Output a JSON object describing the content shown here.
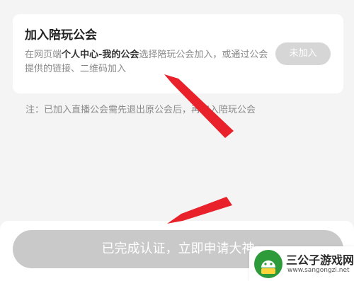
{
  "card": {
    "title": "加入陪玩公会",
    "desc_part1": "在网页端",
    "desc_bold": "个人中心-我的公会",
    "desc_part2": "选择陪玩公会加入，或通过公会提供的链接、二维码加入",
    "join_button": "未加入"
  },
  "note": "注：已加入直播公会需先退出原公会后，再加入陪玩公会",
  "main_button": "已完成认证，立即申请大神",
  "watermark": {
    "title": "三公子游戏网",
    "url": "www.sangongzi.net"
  },
  "colors": {
    "arrow": "#e8212b",
    "button_disabled": "#c9c9c9",
    "background": "#f4f4f4"
  }
}
